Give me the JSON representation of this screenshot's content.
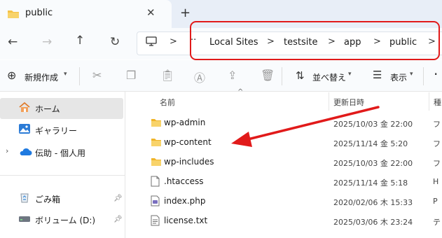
{
  "tab": {
    "title": "public",
    "close": "✕",
    "new": "+"
  },
  "nav": {
    "back": "←",
    "forward": "→",
    "up": "↑",
    "refresh": "↻",
    "more": "··",
    "crumbs": [
      "Local Sites",
      "testsite",
      "app",
      "public"
    ],
    "sep": ">"
  },
  "toolbar": {
    "new_label": "新規作成",
    "sort_label": "並べ替え",
    "view_label": "表示",
    "more": "·"
  },
  "sidebar": {
    "items": [
      {
        "label": "ホーム",
        "icon": "home-icon"
      },
      {
        "label": "ギャラリー",
        "icon": "gallery-icon"
      },
      {
        "label": "伝助 - 個人用",
        "icon": "cloud-icon"
      },
      {
        "label": "ごみ箱",
        "icon": "recycle-bin-icon"
      },
      {
        "label": "ボリューム (D:)",
        "icon": "drive-icon"
      }
    ]
  },
  "list": {
    "col_name": "名前",
    "col_date": "更新日時",
    "col_type": "種",
    "rows": [
      {
        "name": "wp-admin",
        "date": "2025/10/03 金 22:00",
        "type": "フ",
        "icon": "folder-icon"
      },
      {
        "name": "wp-content",
        "date": "2025/11/14 金 5:20",
        "type": "フ",
        "icon": "folder-icon"
      },
      {
        "name": "wp-includes",
        "date": "2025/10/03 金 22:00",
        "type": "フ",
        "icon": "folder-icon"
      },
      {
        "name": ".htaccess",
        "date": "2025/11/14 金 5:18",
        "type": "H",
        "icon": "file-icon"
      },
      {
        "name": "index.php",
        "date": "2020/02/06 木 15:33",
        "type": "P",
        "icon": "php-file-icon"
      },
      {
        "name": "license.txt",
        "date": "2025/03/06 木 23:24",
        "type": "テ",
        "icon": "text-file-icon"
      }
    ]
  },
  "colors": {
    "highlight": "#e11a1a",
    "folder": "#f5c246",
    "arrow": "#e11a1a"
  }
}
